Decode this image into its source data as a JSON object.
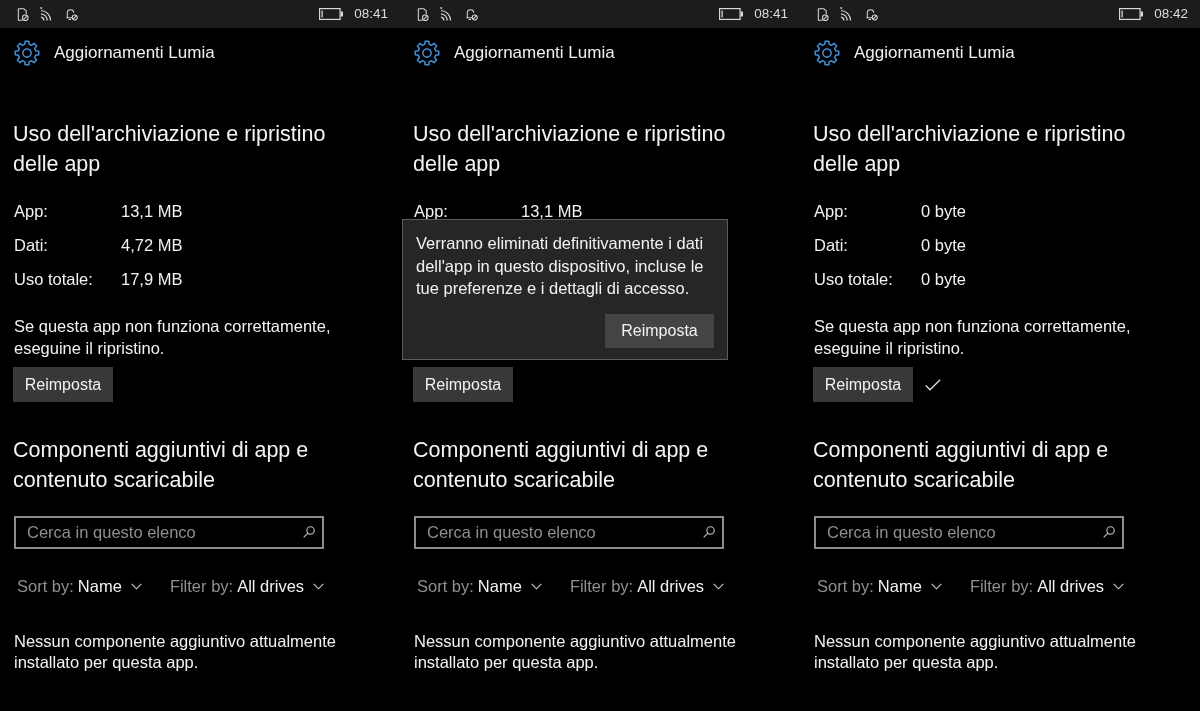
{
  "screens": [
    {
      "status_bar": {
        "time": "08:41"
      },
      "header": {
        "title": "Aggiornamenti Lumia"
      },
      "storage": {
        "heading": "Uso dell'archiviazione e ripristino delle app",
        "rows": [
          {
            "label": "App:",
            "value": "13,1 MB"
          },
          {
            "label": "Dati:",
            "value": "4,72 MB"
          },
          {
            "label": "Uso totale:",
            "value": "17,9 MB"
          }
        ],
        "note": "Se questa app non funziona correttamente, eseguine il ripristino.",
        "reset_button": "Reimposta",
        "reset_done": false
      },
      "addons": {
        "heading": "Componenti aggiuntivi di app e contenuto scaricabile",
        "search": {
          "placeholder": "Cerca in questo elenco"
        },
        "sort": {
          "label": "Sort by:",
          "value": "Name"
        },
        "filter": {
          "label": "Filter by:",
          "value": "All drives"
        },
        "empty_message": "Nessun componente aggiuntivo attualmente installato per questa app."
      }
    },
    {
      "status_bar": {
        "time": "08:41"
      },
      "header": {
        "title": "Aggiornamenti Lumia"
      },
      "storage": {
        "heading": "Uso dell'archiviazione e ripristino delle app",
        "rows": [
          {
            "label": "App:",
            "value": "13,1 MB"
          }
        ],
        "reset_button": "Reimposta",
        "reset_done": false
      },
      "dialog": {
        "message": "Verranno eliminati definitivamente i dati dell'app in questo dispositivo, incluse le tue preferenze e i dettagli di accesso.",
        "button": "Reimposta"
      },
      "addons": {
        "heading": "Componenti aggiuntivi di app e contenuto scaricabile",
        "search": {
          "placeholder": "Cerca in questo elenco"
        },
        "sort": {
          "label": "Sort by:",
          "value": "Name"
        },
        "filter": {
          "label": "Filter by:",
          "value": "All drives"
        },
        "empty_message": "Nessun componente aggiuntivo attualmente installato per questa app."
      }
    },
    {
      "status_bar": {
        "time": "08:42"
      },
      "header": {
        "title": "Aggiornamenti Lumia"
      },
      "storage": {
        "heading": "Uso dell'archiviazione e ripristino delle app",
        "rows": [
          {
            "label": "App:",
            "value": "0 byte"
          },
          {
            "label": "Dati:",
            "value": "0 byte"
          },
          {
            "label": "Uso totale:",
            "value": "0 byte"
          }
        ],
        "note": "Se questa app non funziona correttamente, eseguine il ripristino.",
        "reset_button": "Reimposta",
        "reset_done": true
      },
      "addons": {
        "heading": "Componenti aggiuntivi di app e contenuto scaricabile",
        "search": {
          "placeholder": "Cerca in questo elenco"
        },
        "sort": {
          "label": "Sort by:",
          "value": "Name"
        },
        "filter": {
          "label": "Filter by:",
          "value": "All drives"
        },
        "empty_message": "Nessun componente aggiuntivo attualmente installato per questa app."
      }
    }
  ]
}
